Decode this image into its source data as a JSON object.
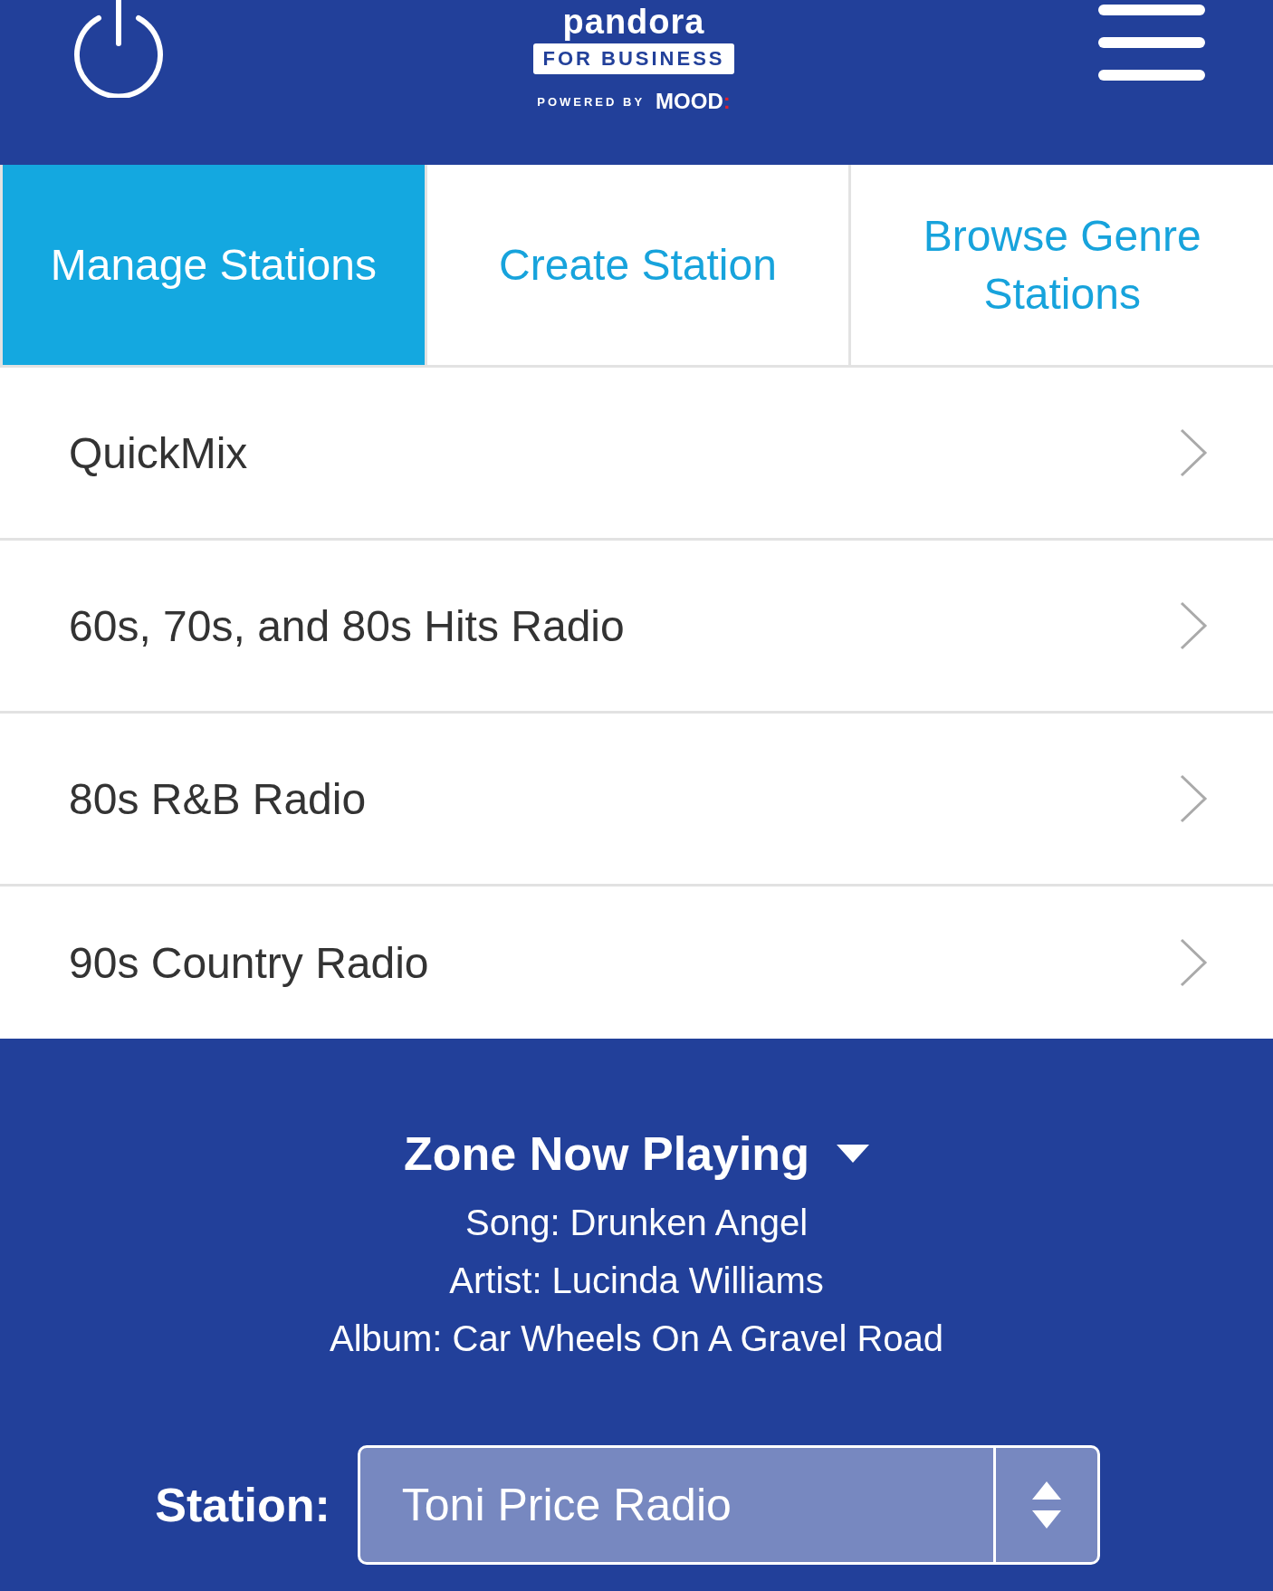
{
  "header": {
    "logo": "pandora",
    "badge": "FOR BUSINESS",
    "powered_by": "POWERED BY",
    "brand": "MOOD",
    "brand_mark": ":"
  },
  "tabs": [
    {
      "label": "Manage Stations",
      "selected": true
    },
    {
      "label": "Create Station",
      "selected": false
    },
    {
      "label": "Browse Genre Stations",
      "selected": false
    }
  ],
  "stations": [
    "QuickMix",
    "60s, 70s, and 80s Hits Radio",
    "80s R&B Radio",
    "90s Country Radio"
  ],
  "now_playing": {
    "title": "Zone Now Playing",
    "lines": [
      "Song: Drunken Angel",
      "Artist: Lucinda Williams",
      "Album: Car Wheels On A Gravel Road"
    ],
    "station_label": "Station:",
    "station_value": "Toni Price Radio"
  }
}
